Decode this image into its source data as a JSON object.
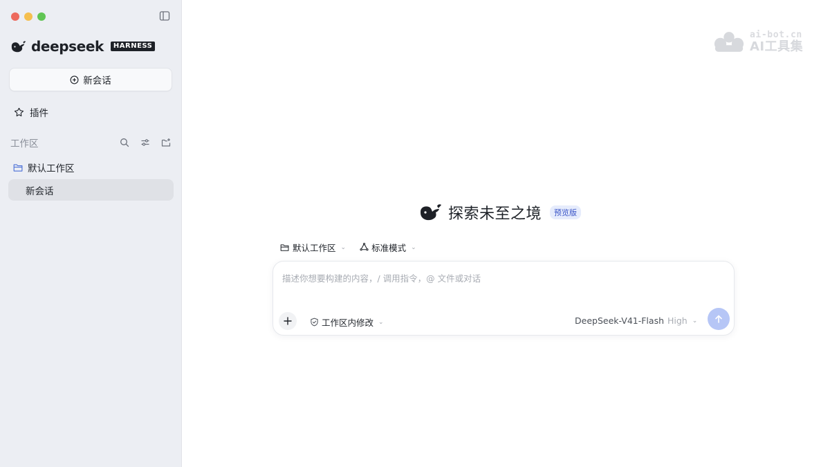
{
  "sidebar": {
    "brand_name": "deepseek",
    "brand_badge": "HARNESS",
    "new_chat_label": "新会话",
    "plugins_label": "插件",
    "workspace_section_label": "工作区",
    "workspace_folder_label": "默认工作区",
    "workspace_chat_label": "新会话",
    "icons": [
      "sidebar-toggle-icon",
      "plus-circle-icon",
      "plugin-icon",
      "search-icon",
      "filter-icon",
      "new-folder-icon",
      "folder-icon"
    ]
  },
  "watermark": {
    "top": "ai-bot.cn",
    "bottom": "AI工具集"
  },
  "main": {
    "hero_title": "探索未至之境",
    "preview_badge": "预览版",
    "workspace_selector": "默认工作区",
    "mode_selector": "标准模式",
    "composer": {
      "placeholder": "描述你想要构建的内容，/ 调用指令，@ 文件或对话",
      "permission_label": "工作区内修改",
      "model_name": "DeepSeek-V41-Flash",
      "model_level": "High"
    }
  },
  "colors": {
    "sidebar_bg": "#eceef3",
    "accent": "#3a55c7",
    "send_button": "#b6c6f6",
    "traffic_red": "#ed6a5e",
    "traffic_yellow": "#f5bf4f",
    "traffic_green": "#61c554"
  }
}
